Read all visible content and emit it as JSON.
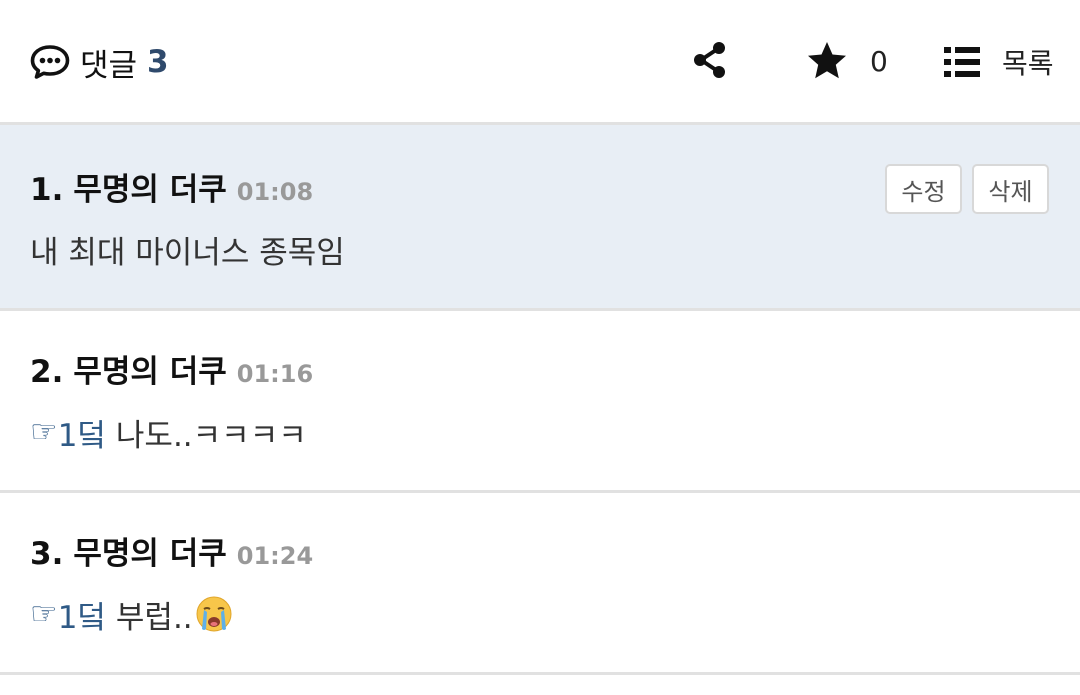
{
  "header": {
    "comments_label": "댓글",
    "comments_count": "3",
    "star_count": "0",
    "list_label": "목록"
  },
  "comments": [
    {
      "number": "1.",
      "author": "무명의 더쿠",
      "time": "01:08",
      "text": "내 최대 마이너스 종목임",
      "edit_label": "수정",
      "delete_label": "삭제"
    },
    {
      "number": "2.",
      "author": "무명의 더쿠",
      "time": "01:16",
      "pointer": "☞",
      "reply_ref": "1덬",
      "text": " 나도..ㅋㅋㅋㅋ"
    },
    {
      "number": "3.",
      "author": "무명의 더쿠",
      "time": "01:24",
      "pointer": "☞",
      "reply_ref": "1덬",
      "text": " 부럽.."
    }
  ],
  "colors": {
    "accent": "#2f4a6c",
    "highlight_bg": "#e8eef5",
    "time_gray": "#999999"
  },
  "icons": {
    "comment": "speech-bubble-icon",
    "share": "share-icon",
    "star": "star-icon",
    "list": "list-icon",
    "crying_emoji": "loudly-crying-face-emoji"
  }
}
